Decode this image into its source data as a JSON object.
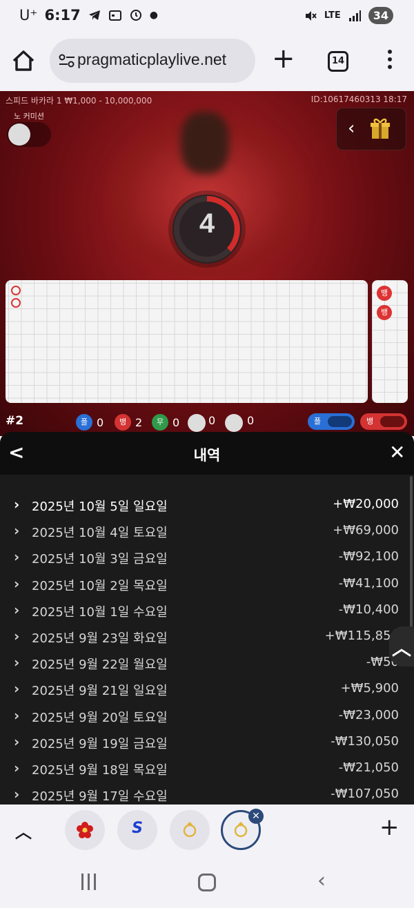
{
  "status_bar": {
    "carrier": "U⁺",
    "time": "6:17",
    "network": "LTE",
    "battery": "34"
  },
  "browser": {
    "url": "pragmaticplaylive.net",
    "tab_count": "14"
  },
  "game": {
    "table_info": "스피드 바카라 1 ₩1,000 - 10,000,000",
    "round_id": "ID:10617460313 18:17",
    "commission_label": "노 커미션",
    "countdown": "4",
    "round_number": "#2",
    "stats": {
      "player_label": "플",
      "player_count": "0",
      "banker_label": "뱅",
      "banker_count": "2",
      "tie_label": "무",
      "tie_count": "0",
      "player_pair_count": "0",
      "banker_pair_count": "0"
    },
    "side_beads": [
      "뱅",
      "뱅"
    ],
    "bet_pills": {
      "player": "플",
      "banker": "뱅"
    }
  },
  "history": {
    "title": "내역",
    "rows": [
      {
        "date": "2025년 10월 5일 일요일",
        "amount": "+₩20,000"
      },
      {
        "date": "2025년 10월 4일 토요일",
        "amount": "+₩69,000"
      },
      {
        "date": "2025년 10월 3일 금요일",
        "amount": "-₩92,100"
      },
      {
        "date": "2025년 10월 2일 목요일",
        "amount": "-₩41,100"
      },
      {
        "date": "2025년 10월 1일 수요일",
        "amount": "-₩10,400"
      },
      {
        "date": "2025년 9월 23일 화요일",
        "amount": "+₩115,850"
      },
      {
        "date": "2025년 9월 22일 월요일",
        "amount": "-₩50"
      },
      {
        "date": "2025년 9월 21일 일요일",
        "amount": "+₩5,900"
      },
      {
        "date": "2025년 9월 20일 토요일",
        "amount": "-₩23,000"
      },
      {
        "date": "2025년 9월 19일 금요일",
        "amount": "-₩130,050"
      },
      {
        "date": "2025년 9월 18일 목요일",
        "amount": "-₩21,050"
      },
      {
        "date": "2025년 9월 17일 수요일",
        "amount": "-₩107,050"
      }
    ]
  },
  "tabstrip": {
    "favicons": [
      "flower-favicon",
      "s-favicon",
      "ring-favicon",
      "ring-favicon-active"
    ],
    "s_glyph": "S"
  },
  "colors": {
    "banker_red": "#d33333",
    "player_blue": "#2a6fd6",
    "tie_green": "#2f9a4a",
    "sheet_bg": "#1b1b1b"
  }
}
